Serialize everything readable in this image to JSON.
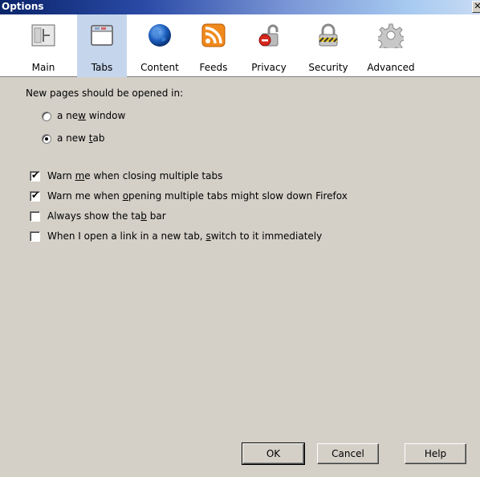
{
  "window": {
    "title": "Options"
  },
  "toolbar": {
    "items": [
      {
        "label": "Main",
        "icon": "main-window-icon"
      },
      {
        "label": "Tabs",
        "icon": "tabs-icon",
        "selected": true
      },
      {
        "label": "Content",
        "icon": "globe-icon"
      },
      {
        "label": "Feeds",
        "icon": "rss-icon"
      },
      {
        "label": "Privacy",
        "icon": "privacy-lock-icon"
      },
      {
        "label": "Security",
        "icon": "padlock-icon"
      },
      {
        "label": "Advanced",
        "icon": "gear-icon"
      }
    ]
  },
  "tabs_pane": {
    "open_in_label": "New pages should be opened in:",
    "radio_new_window": {
      "pre": "a ne",
      "key": "w",
      "post": " window",
      "selected": false
    },
    "radio_new_tab": {
      "pre": "a new ",
      "key": "t",
      "post": "ab",
      "selected": true
    },
    "checkboxes": [
      {
        "pre": "Warn ",
        "key": "m",
        "post": "e when closing multiple tabs",
        "checked": true
      },
      {
        "pre": "Warn me when ",
        "key": "o",
        "post": "pening multiple tabs might slow down Firefox",
        "checked": true
      },
      {
        "pre": "Always show the ta",
        "key": "b",
        "post": " bar",
        "checked": false
      },
      {
        "pre": "When I open a link in a new tab, ",
        "key": "s",
        "post": "witch to it immediately",
        "checked": false
      }
    ]
  },
  "buttons": {
    "ok": "OK",
    "cancel": "Cancel",
    "help": "Help"
  },
  "colors": {
    "selected_toolbar": "#c5d5ec",
    "dialog_bg": "#d4d0c8",
    "title_start": "#0a246a"
  }
}
